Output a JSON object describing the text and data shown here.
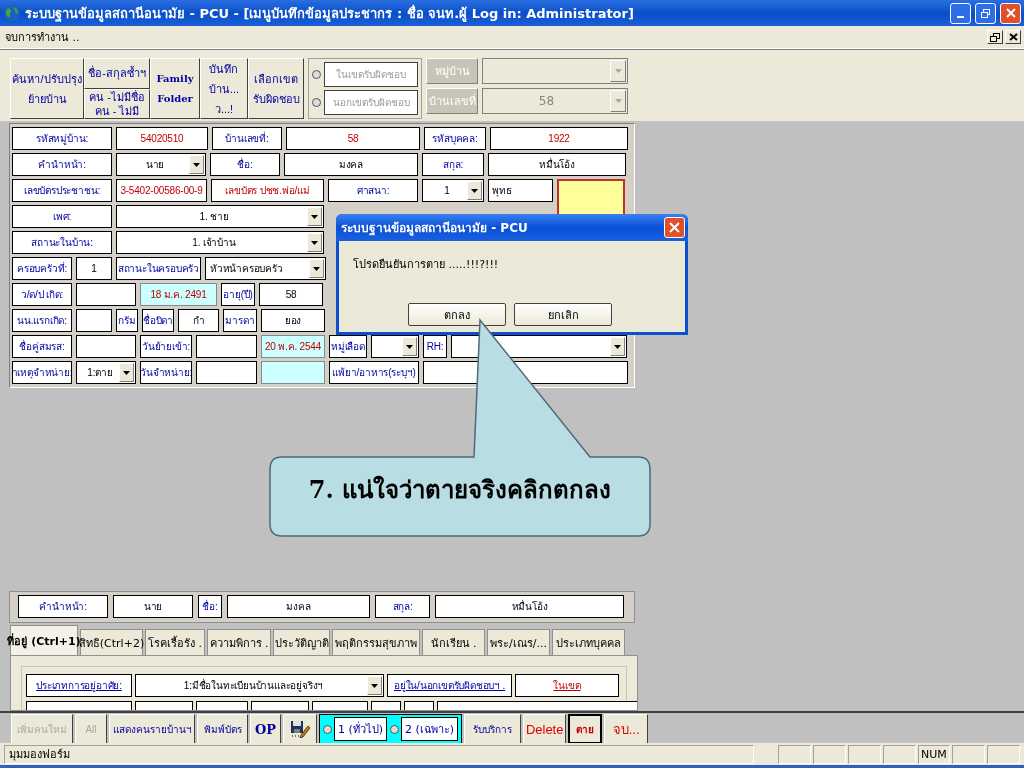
{
  "window": {
    "title": "ระบบฐานข้อมูลสถานีอนามัย - PCU - [เมนูบันทึกข้อมูลประชากร : ชื่อ จนท.ผู้ Log in: Administrator]"
  },
  "menu": {
    "items": [
      "จบการทำงาน .."
    ]
  },
  "toolbar": {
    "buttons": [
      {
        "kind": "single",
        "lines": [
          "ค้นหา/ปรับปรุง",
          "ย้ายบ้าน"
        ]
      },
      {
        "kind": "stack",
        "parts": [
          [
            "ชื่อ-สกุลซ้ำฯ"
          ],
          [
            "คน -ไม่มีชื่อ",
            "คน - ไม่มี"
          ]
        ]
      },
      {
        "kind": "serif",
        "lines": [
          "Family",
          "Folder"
        ]
      },
      {
        "kind": "single",
        "lines": [
          "บันทึก",
          "บ้าน...",
          "ว...!"
        ]
      },
      {
        "kind": "single",
        "lines": [
          "เลือกเขต",
          "รับผิดชอบ"
        ]
      }
    ],
    "scope": [
      {
        "label": "ในเขตรับผิดชอบ",
        "selected": false
      },
      {
        "label": "นอกเขตรับผิดชอบ",
        "selected": false
      }
    ],
    "lookups": [
      {
        "label": "หมู่บ้าน",
        "disabled": true
      },
      {
        "label": "บ้านเลขที่",
        "value": "58",
        "disabled": true
      }
    ]
  },
  "form": {
    "rows": [
      [
        {
          "kind": "label",
          "text": "รหัสหมู่บ้าน:"
        },
        {
          "kind": "value-red",
          "text": "54020510"
        },
        {
          "kind": "label",
          "text": "บ้านเลขที่:"
        },
        {
          "kind": "value-red",
          "text": "58"
        },
        {
          "kind": "label",
          "text": "รหัสบุคคล:"
        },
        {
          "kind": "value-red",
          "text": "1922"
        }
      ],
      [
        {
          "kind": "label",
          "text": "คำนำหน้า:"
        },
        {
          "kind": "combo",
          "text": "นาย"
        },
        {
          "kind": "label",
          "text": "ชื่อ:"
        },
        {
          "kind": "value",
          "text": "มงคล"
        },
        {
          "kind": "label",
          "text": "สกุล:"
        },
        {
          "kind": "value",
          "text": "หมื่นโอ้ง"
        }
      ],
      [
        {
          "kind": "label",
          "text": "เลขบัตรประชาชน:"
        },
        {
          "kind": "value-red",
          "text": "3-5402-00586-00-9"
        },
        {
          "kind": "label-red",
          "text": "เลขบัตร ปชช.พ่อ/แม่"
        },
        {
          "kind": "label",
          "text": "ศาสนา:"
        },
        {
          "kind": "combo",
          "text": "1"
        },
        {
          "kind": "value-left",
          "text": "พุทธ"
        },
        {
          "kind": "photo"
        }
      ],
      [
        {
          "kind": "label",
          "text": "เพศ:"
        },
        {
          "kind": "combo",
          "text": "1. ชาย"
        }
      ],
      [
        {
          "kind": "label",
          "text": "สถานะในบ้าน:"
        },
        {
          "kind": "combo",
          "text": "1. เจ้าบ้าน"
        }
      ],
      [
        {
          "kind": "label",
          "text": "ครอบครัวที่:"
        },
        {
          "kind": "value",
          "text": "1"
        },
        {
          "kind": "label",
          "text": "สถานะในครอบครัว"
        },
        {
          "kind": "combo-left",
          "text": "หัวหน้าครอบครัว"
        }
      ],
      [
        {
          "kind": "label",
          "text": "ว/ด/ป เกิด:"
        },
        {
          "kind": "value"
        },
        {
          "kind": "date",
          "text": "18 ม.ค. 2491"
        },
        {
          "kind": "label",
          "text": "อายุ(ปี)"
        },
        {
          "kind": "value",
          "text": "58"
        }
      ],
      [
        {
          "kind": "label",
          "text": "นน.แรกเกิด:"
        },
        {
          "kind": "value"
        },
        {
          "kind": "label",
          "text": "กรัม"
        },
        {
          "kind": "label",
          "text": "ชื่อบิดา"
        },
        {
          "kind": "value",
          "text": "กำ"
        },
        {
          "kind": "label",
          "text": "มารดา"
        },
        {
          "kind": "value",
          "text": "ยอง"
        }
      ],
      [
        {
          "kind": "label",
          "text": "ชื่อคู่สมรส:"
        },
        {
          "kind": "value"
        },
        {
          "kind": "label",
          "text": "วันย้ายเข้า:"
        },
        {
          "kind": "value"
        },
        {
          "kind": "date",
          "text": "20 พ.ค. 2544"
        },
        {
          "kind": "label",
          "text": "หมู่เลือด"
        },
        {
          "kind": "combo"
        },
        {
          "kind": "label",
          "text": "RH:"
        },
        {
          "kind": "combo"
        }
      ],
      [
        {
          "kind": "label",
          "text": "าเหตุจำหน่าย:"
        },
        {
          "kind": "combo",
          "text": "1:ตาย"
        },
        {
          "kind": "label",
          "text": "วันจำหน่าย:"
        },
        {
          "kind": "value"
        },
        {
          "kind": "date"
        },
        {
          "kind": "label",
          "text": "แพ้ยา/อาหาร(ระบุฯ)"
        },
        {
          "kind": "value"
        }
      ]
    ]
  },
  "summary": [
    {
      "kind": "label",
      "text": "คำนำหน้า:"
    },
    {
      "kind": "value",
      "text": "นาย"
    },
    {
      "kind": "label",
      "text": "ชื่อ:"
    },
    {
      "kind": "value",
      "text": "มงคล"
    },
    {
      "kind": "label",
      "text": "สกุล:"
    },
    {
      "kind": "value",
      "text": "หมื่นโอ้ง"
    }
  ],
  "tabs": [
    {
      "label": "ที่อยู่ (Ctrl+1)",
      "selected": true
    },
    {
      "label": "สิทธิ(Ctrl+2)",
      "selected": false
    },
    {
      "label": "โรคเรื้อรัง .",
      "selected": false
    },
    {
      "label": "ความพิการ .",
      "selected": false
    },
    {
      "label": "ประวัติญาติ",
      "selected": false
    },
    {
      "label": "พฤติกรรมสุขภาพ",
      "selected": false
    },
    {
      "label": "นักเรียน .",
      "selected": false
    },
    {
      "label": "พระ/เณร/...",
      "selected": false
    },
    {
      "label": "ประเภทบุคคล",
      "selected": false
    }
  ],
  "address": [
    {
      "kind": "link",
      "text": "ประเภทการอยู่อาศัย:"
    },
    {
      "kind": "combo",
      "text": "1:มีชื่อในทะเบียนบ้านและอยู่จริงฯ"
    },
    {
      "kind": "link",
      "text": "อยู่ใน/นอกเขตรับผิดชอบฯ ."
    },
    {
      "kind": "value-link",
      "text": "ในเขต"
    }
  ],
  "actions": [
    {
      "kind": "text",
      "label": "เพิ่มคนใหม่",
      "disabled": true
    },
    {
      "kind": "text",
      "label": "All",
      "disabled": true
    },
    {
      "kind": "text",
      "label": "แสดงคนรายบ้านฯ",
      "disabled": false
    },
    {
      "kind": "text",
      "label": "พิมพ์บัตร",
      "disabled": false
    },
    {
      "kind": "serif",
      "label": "OP",
      "disabled": false
    },
    {
      "kind": "icon",
      "disabled": false
    },
    {
      "kind": "radios",
      "disabled": false,
      "options": [
        {
          "label": "1 (ทั่วไป)",
          "selected": false
        },
        {
          "label": "2 (เฉพาะ)",
          "selected": false
        }
      ]
    },
    {
      "kind": "text",
      "label": "รับบริการ",
      "disabled": false
    },
    {
      "kind": "danger",
      "label": "Delete",
      "disabled": false
    },
    {
      "kind": "danger-boxed",
      "label": "ตาย",
      "disabled": false
    },
    {
      "kind": "danger",
      "label": "จบ...",
      "disabled": false
    }
  ],
  "status_bar": {
    "text": "มุมมองฟอร์ม",
    "indicators": [
      "NUM"
    ]
  },
  "dialog": {
    "title": "ระบบฐานข้อมูลสถานีอนามัย - PCU",
    "message": "โปรดยืนยันการตาย .....!!!?!!!",
    "buttons": [
      "ตกลง",
      "ยกเลิก"
    ]
  },
  "callout": {
    "text": "7. แน่ใจว่าตายจริงคลิกตกลง"
  }
}
